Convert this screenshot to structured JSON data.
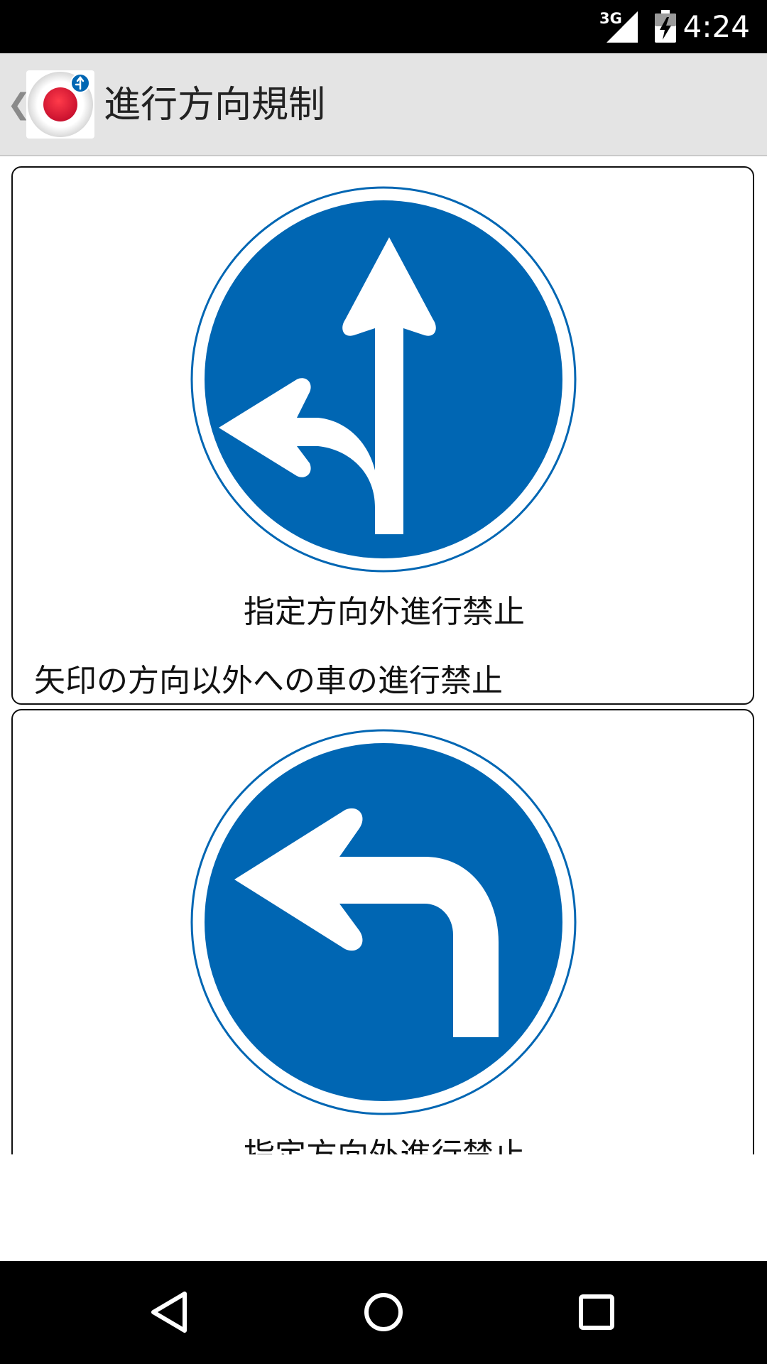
{
  "status_bar": {
    "network": "3G",
    "time": "4:24",
    "icons": [
      "signal-icon",
      "battery-charging-icon"
    ]
  },
  "action_bar": {
    "title": "進行方向規制",
    "up_icon": "chevron-left-icon",
    "app_icon": "japan-flag-icon"
  },
  "colors": {
    "sign_blue": "#0066b3",
    "action_bar_bg": "#e4e4e4",
    "status_bar_bg": "#000000"
  },
  "signs": [
    {
      "name": "指定方向外進行禁止",
      "description": "矢印の方向以外への車の進行禁止",
      "icon": "straight-or-left-arrow-sign-icon"
    },
    {
      "name": "指定方向外進行禁止",
      "description": "",
      "icon": "left-turn-arrow-sign-icon"
    }
  ],
  "nav_bar": {
    "icons": [
      "back-triangle-icon",
      "home-circle-icon",
      "recents-square-icon"
    ]
  }
}
